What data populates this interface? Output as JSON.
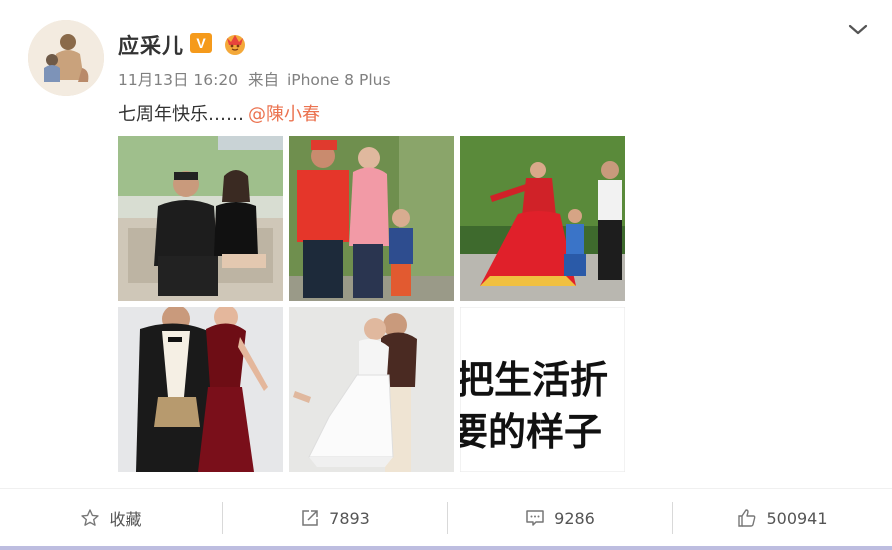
{
  "post": {
    "author": "应采儿",
    "verified_badge": "V",
    "timestamp": "11月13日 16:20",
    "source_prefix": "来自",
    "source": "iPhone 8 Plus",
    "text": "七周年快乐……",
    "mention": "@陳小春"
  },
  "photos": [
    {
      "name": "family-sofa-photo"
    },
    {
      "name": "couple-kiss-photo"
    },
    {
      "name": "ethnic-dance-photo"
    },
    {
      "name": "formal-couple-photo"
    },
    {
      "name": "wedding-hug-photo"
    },
    {
      "name": "calligraphy-photo",
      "lines": [
        "把生活折",
        "要的样子"
      ]
    }
  ],
  "actions": {
    "favorite_label": "收藏",
    "repost_count": "7893",
    "comment_count": "9286",
    "like_count": "500941"
  },
  "colors": {
    "mention": "#eb7350",
    "verified": "#f59a1b",
    "text": "#333333",
    "meta": "#808080"
  }
}
